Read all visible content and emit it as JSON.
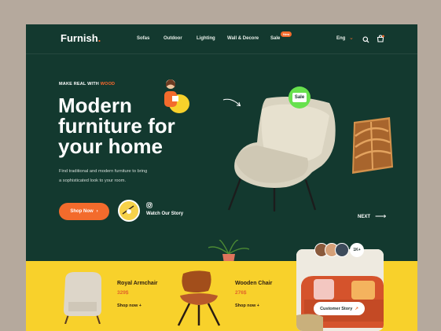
{
  "nav": {
    "logo_text": "Furnish",
    "logo_dot": ".",
    "items": [
      {
        "label": "Sofas"
      },
      {
        "label": "Outdoor"
      },
      {
        "label": "Lighting"
      },
      {
        "label": "Wall & Decore"
      },
      {
        "label": "Sale",
        "badge": "New"
      }
    ],
    "language": "Eng",
    "icons": {
      "dropdown": "chevron-down-icon",
      "search": "search-icon",
      "cart": "cart-icon"
    }
  },
  "hero": {
    "kicker_prefix": "MAKE REAL WITH ",
    "kicker_accent": "WOOD",
    "headline_line1": "Modern",
    "headline_line2": "furniture for",
    "headline_line3": "your home",
    "description_line1": "Find traditional and modern furniture to bring",
    "description_line2": "a sophisticated look to your room.",
    "shop_button": "Shop Now",
    "shop_button_arrow": "›",
    "watch_label": "Watch Our Story",
    "sale_badge": "Sale",
    "next_label": "NEXT",
    "next_arrow": "⟶"
  },
  "products": [
    {
      "name": "Royal Armchair",
      "price": "329$",
      "link": "Shop now +"
    },
    {
      "name": "Wooden Chair",
      "price": "276$",
      "link": "Shop now +"
    }
  ],
  "story_card": {
    "count": "1K+",
    "button_label": "Customer Story",
    "button_arrow": "↗"
  },
  "colors": {
    "background": "#b5a99d",
    "hero": "#13392f",
    "accent": "#f36b2c",
    "yellow": "#f8d12b",
    "sale_green": "#67e14d"
  }
}
